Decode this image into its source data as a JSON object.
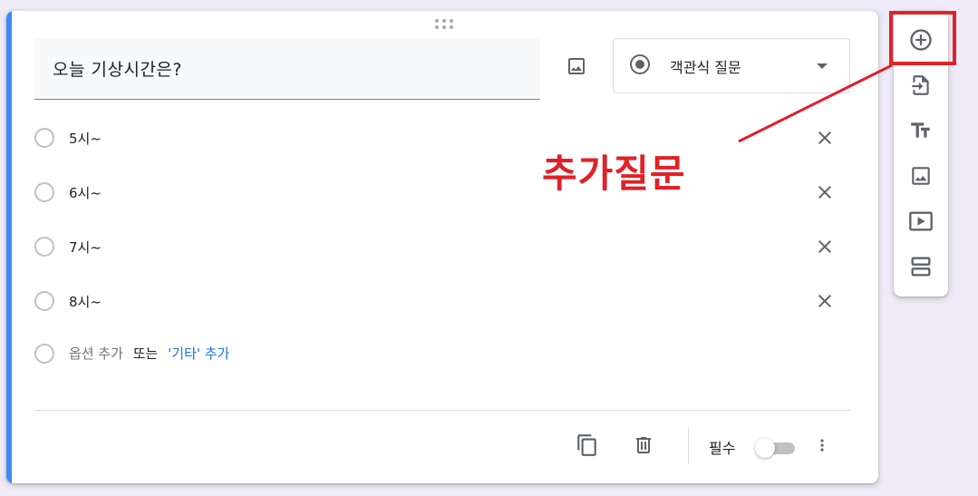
{
  "question": {
    "title": "오늘 기상시간은?",
    "type_label": "객관식 질문"
  },
  "options": [
    {
      "label": "5시~"
    },
    {
      "label": "6시~"
    },
    {
      "label": "7시~"
    },
    {
      "label": "8시~"
    }
  ],
  "add_option": {
    "add_label": "옵션 추가",
    "or_label": "또는",
    "add_other_label": "'기타' 추가"
  },
  "footer": {
    "required_label": "필수",
    "required_on": false
  },
  "annotation": {
    "text": "추가질문",
    "color": "#e02128"
  },
  "toolbar_icons": [
    "add-question-icon",
    "import-questions-icon",
    "add-title-icon",
    "add-image-icon",
    "add-video-icon",
    "add-section-icon"
  ],
  "colors": {
    "accent": "#4285f4",
    "background": "#f0ebf8",
    "link": "#1a73e8"
  }
}
